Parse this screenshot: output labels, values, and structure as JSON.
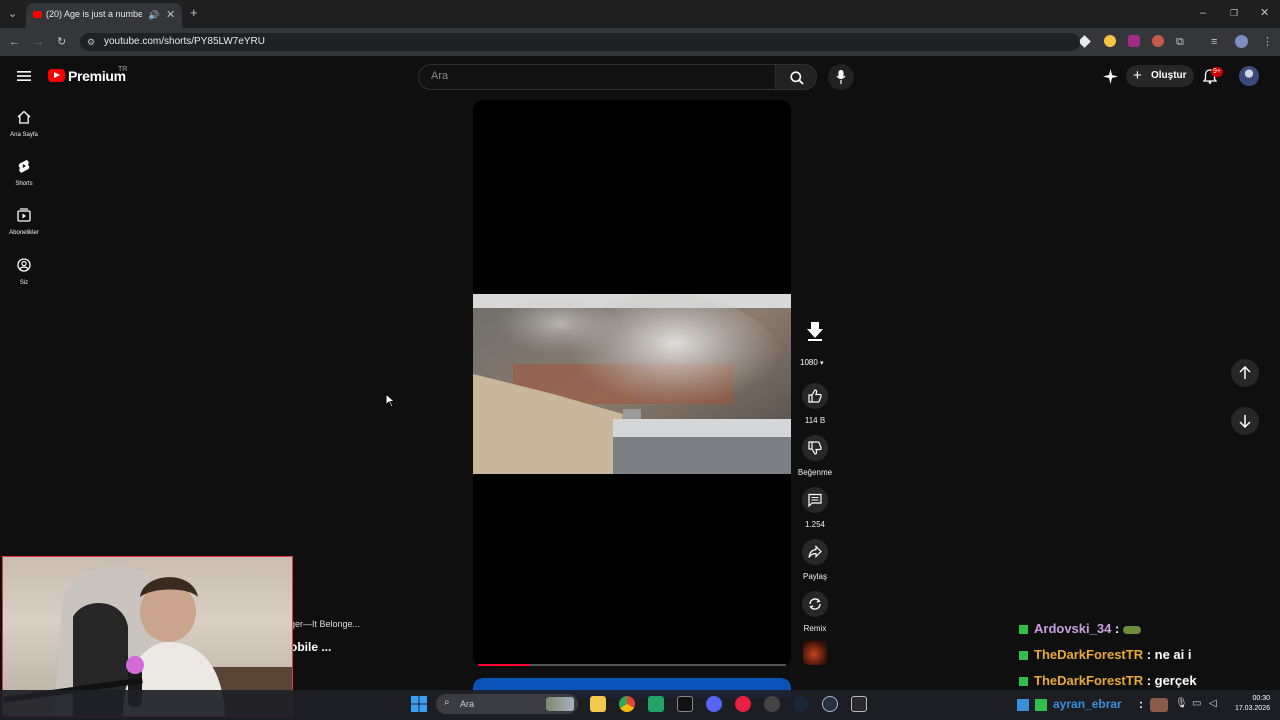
{
  "browser": {
    "tab_title": "(20) Age is just a number...",
    "url": "youtube.com/shorts/PY85LW7eYRU"
  },
  "header": {
    "logo_text": "Premium",
    "logo_region": "TR",
    "search_placeholder": "Ara",
    "create_label": "Oluştur",
    "notification_count": "9+"
  },
  "sidebar": {
    "items": [
      {
        "label": "Ana Sayfa",
        "icon": "home-icon"
      },
      {
        "label": "Shorts",
        "icon": "shorts-icon"
      },
      {
        "label": "Abonelikler",
        "icon": "subscriptions-icon"
      },
      {
        "label": "Siz",
        "icon": "account-icon"
      }
    ]
  },
  "short": {
    "channel_line": "ger—It Belonge...",
    "title": "obile ...",
    "progress_fraction": 0.17
  },
  "actions": {
    "quality": "1080",
    "like_count": "114 B",
    "dislike_label": "Beğenme",
    "comment_count": "1.254",
    "share_label": "Paylaş",
    "remix_label": "Remix"
  },
  "chat": [
    {
      "user": "Ardovski_34",
      "sep": " : ",
      "message": "",
      "user_color": "#c9a0dc"
    },
    {
      "user": "TheDarkForestTR",
      "sep": " : ",
      "message": "ne ai i",
      "user_color": "#e6a93b"
    },
    {
      "user": "TheDarkForestTR",
      "sep": " : ",
      "message": "gerçek",
      "user_color": "#e6a93b"
    },
    {
      "user": "ayran_ebrar",
      "sep": " : ",
      "message": "",
      "user_color": "#3b8fd9"
    }
  ],
  "taskbar": {
    "search_placeholder": "Ara",
    "time": "00:30",
    "date": "17.03.2026"
  }
}
